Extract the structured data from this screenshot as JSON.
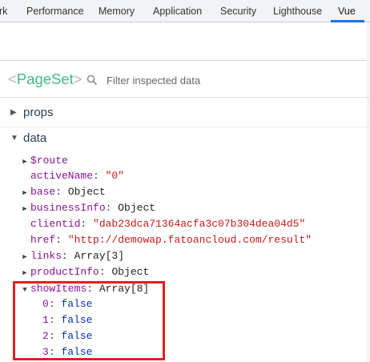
{
  "tabs": [
    {
      "label": "rk"
    },
    {
      "label": "Performance"
    },
    {
      "label": "Memory"
    },
    {
      "label": "Application"
    },
    {
      "label": "Security"
    },
    {
      "label": "Lighthouse"
    },
    {
      "label": "Vue",
      "active": true
    }
  ],
  "component": {
    "open_bracket": "<",
    "name": "PageSet",
    "close_bracket": ">"
  },
  "filter": {
    "placeholder": "Filter inspected data"
  },
  "sections": {
    "props": {
      "label": "props",
      "expanded": false
    },
    "data": {
      "label": "data",
      "expanded": true
    }
  },
  "data_items": [
    {
      "key": "$route",
      "value": "",
      "collapsed": true
    },
    {
      "key": "activeName",
      "value": "\"0\"",
      "kind": "string"
    },
    {
      "key": "base",
      "value": "Object",
      "collapsed": true,
      "kind": "type"
    },
    {
      "key": "businessInfo",
      "value": "Object",
      "collapsed": true,
      "kind": "type"
    },
    {
      "key": "clientid",
      "value": "\"dab23dca71364acfa3c07b304dea04d5\"",
      "kind": "string"
    },
    {
      "key": "href",
      "value": "\"http://demowap.fatoancloud.com/result\"",
      "kind": "string"
    },
    {
      "key": "links",
      "value": "Array[3]",
      "collapsed": true,
      "kind": "type"
    },
    {
      "key": "productInfo",
      "value": "Object",
      "collapsed": true,
      "kind": "type"
    },
    {
      "key": "showItems",
      "value": "Array[8]",
      "expanded": true,
      "kind": "type"
    }
  ],
  "show_items": [
    {
      "key": "0",
      "value": "false"
    },
    {
      "key": "1",
      "value": "false"
    },
    {
      "key": "2",
      "value": "false"
    },
    {
      "key": "3",
      "value": "false"
    }
  ],
  "colors": {
    "vue_green": "#42b983",
    "key_purple": "#881391",
    "string_red": "#c41a16",
    "highlight_red": "#e02020"
  }
}
